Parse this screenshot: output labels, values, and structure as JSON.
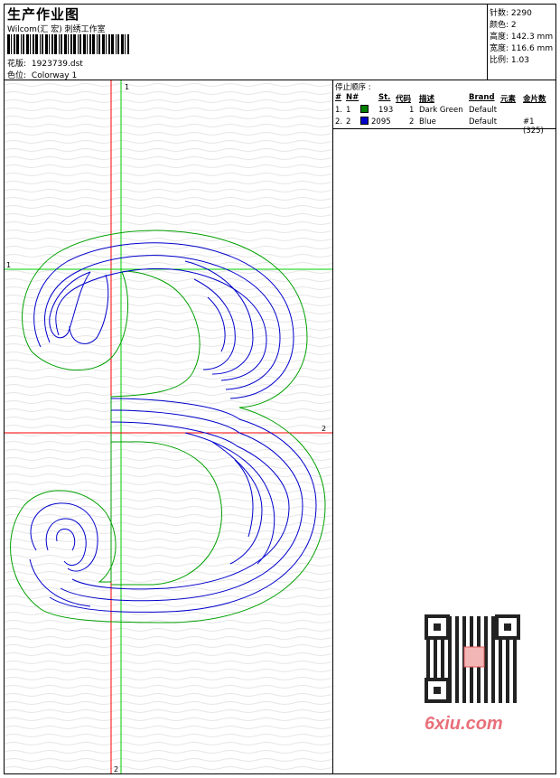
{
  "header": {
    "title": "生产作业图",
    "company": "Wilcom(汇 宏) 刺绣工作室",
    "design_label": "花版:",
    "design_value": "1923739.dst",
    "colorway_label": "色位:",
    "colorway_value": "Colorway 1"
  },
  "stats": {
    "stitches_label": "针数:",
    "stitches_value": "2290",
    "colors_label": "颜色:",
    "colors_value": "2",
    "height_label": "高度:",
    "height_value": "142.3 mm",
    "width_label": "宽度:",
    "width_value": "116.6 mm",
    "scale_label": "比例:",
    "scale_value": "1.03"
  },
  "stop_sequence": {
    "label": "停止顺序 :",
    "columns": [
      "#",
      "N#",
      "St.",
      "代码",
      "描述",
      "Brand",
      "元素",
      "金片数"
    ],
    "rows": [
      {
        "num": "1.",
        "n": "1",
        "color": "#008000",
        "st": "193",
        "code": "1",
        "desc": "Dark Green",
        "brand": "Default",
        "element": "",
        "sequins": ""
      },
      {
        "num": "2.",
        "n": "2",
        "color": "#0000cc",
        "st": "2095",
        "code": "2",
        "desc": "Blue",
        "brand": "Default",
        "element": "",
        "sequins": "#1 (325)"
      }
    ]
  },
  "guides": {
    "v1_label": "1",
    "v2_label": "2",
    "h1_label": "1",
    "h2_label": "2"
  },
  "watermark": {
    "site": "6xiu.com"
  },
  "colors": {
    "outline": "#00a000",
    "fill_stitch": "#0000cc",
    "guide_red": "#ff0000",
    "guide_green": "#00cc00"
  }
}
